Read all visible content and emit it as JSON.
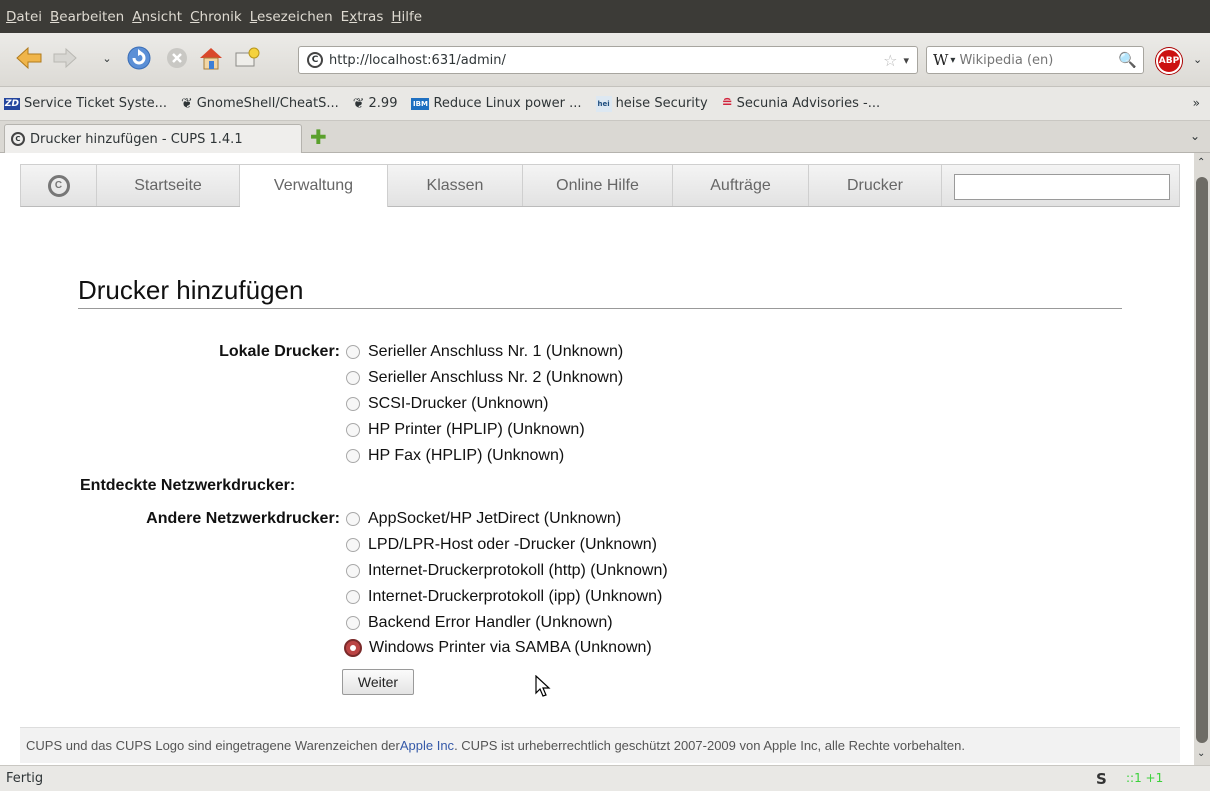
{
  "menu": [
    "Datei",
    "Bearbeiten",
    "Ansicht",
    "Chronik",
    "Lesezeichen",
    "Extras",
    "Hilfe"
  ],
  "menu_access_keys": [
    "D",
    "B",
    "A",
    "C",
    "L",
    "x",
    "H"
  ],
  "navigation": {
    "url": "http://localhost:631/admin/",
    "search_engine": "W",
    "search_placeholder": "Wikipedia (en)",
    "abp_label": "ABP"
  },
  "bookmarks": [
    {
      "icon": "ZD",
      "label": "Service Ticket Syste..."
    },
    {
      "icon": "gnome",
      "label": "GnomeShell/CheatS..."
    },
    {
      "icon": "gnome",
      "label": "2.99"
    },
    {
      "icon": "IBM",
      "label": "Reduce Linux power ..."
    },
    {
      "icon": "hei",
      "label": "heise Security"
    },
    {
      "icon": "sec",
      "label": "Secunia Advisories -..."
    }
  ],
  "tab": {
    "title": "Drucker hinzufügen - CUPS 1.4.1"
  },
  "cups_nav": [
    "Startseite",
    "Verwaltung",
    "Klassen",
    "Online Hilfe",
    "Aufträge",
    "Drucker"
  ],
  "page": {
    "title": "Drucker hinzufügen",
    "local_label": "Lokale Drucker:",
    "local_printers": [
      "Serieller Anschluss Nr. 1 (Unknown)",
      "Serieller Anschluss Nr. 2 (Unknown)",
      "SCSI-Drucker (Unknown)",
      "HP Printer (HPLIP) (Unknown)",
      "HP Fax (HPLIP) (Unknown)"
    ],
    "discovered_label": "Entdeckte Netzwerkdrucker:",
    "other_label": "Andere Netzwerkdrucker:",
    "other_printers": [
      "AppSocket/HP JetDirect (Unknown)",
      "LPD/LPR-Host oder -Drucker (Unknown)",
      "Internet-Druckerprotokoll (http) (Unknown)",
      "Internet-Druckerprotokoll (ipp) (Unknown)",
      "Backend Error Handler (Unknown)",
      "Windows Printer via SAMBA (Unknown)"
    ],
    "selected_other_index": 5,
    "continue_button": "Weiter"
  },
  "footer": {
    "pre": "CUPS und das CUPS Logo sind eingetragene Warenzeichen der ",
    "link": "Apple Inc",
    "post": ". CUPS ist urheberrechtlich geschützt 2007-2009 von Apple Inc, alle Rechte vorbehalten."
  },
  "status": {
    "text": "Fertig",
    "ip_indicator": "::1 +1"
  },
  "colors": {
    "menubar": "#3c3b37",
    "link": "#3559a8",
    "selected_radio": "#b44444"
  }
}
